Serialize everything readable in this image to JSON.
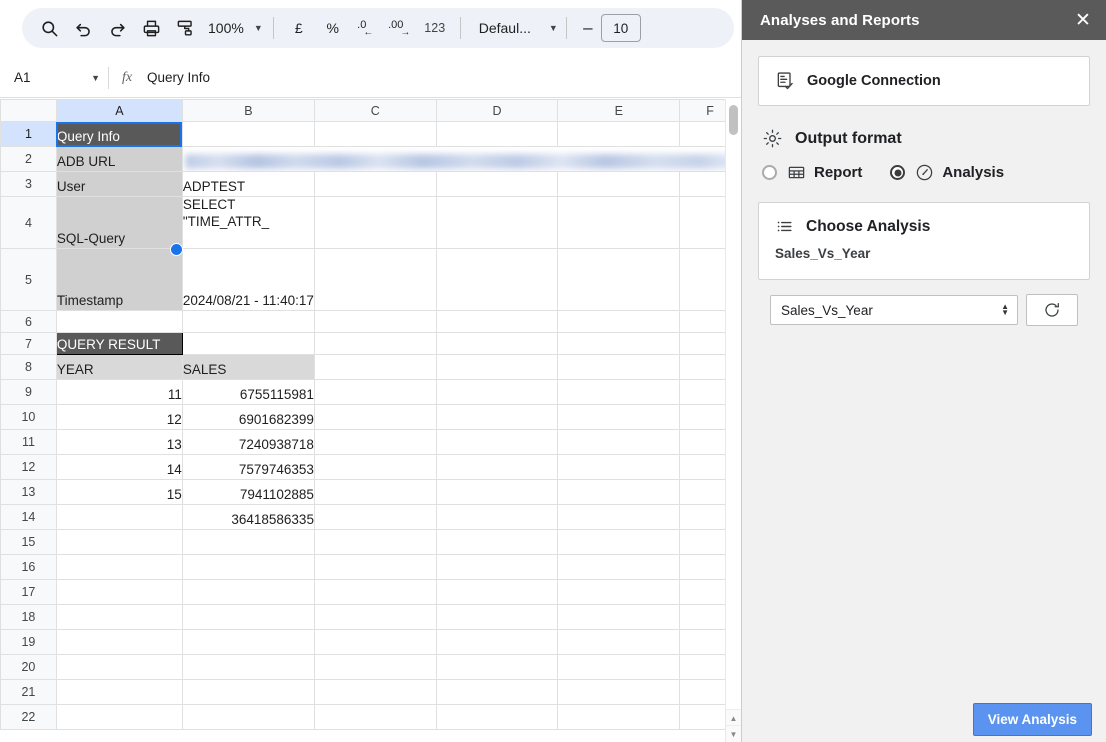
{
  "toolbar": {
    "search_icon": "search-icon",
    "undo_icon": "undo-icon",
    "redo_icon": "redo-icon",
    "print_icon": "print-icon",
    "paint_format_icon": "paint-format-icon",
    "zoom_value": "100%",
    "currency_label": "£",
    "percent_label": "%",
    "decrease_decimal_label": ".0",
    "increase_decimal_label": ".00",
    "number_format_label": "123",
    "font_name": "Defaul...",
    "font_decrease_label": "–",
    "font_size": "10"
  },
  "formula_bar": {
    "name_box": "A1",
    "fx_label": "fx",
    "content": "Query Info"
  },
  "grid": {
    "columns": [
      "A",
      "B",
      "C",
      "D",
      "E",
      "F"
    ],
    "selected_cell": "A1",
    "rows": [
      {
        "n": "1",
        "a": "Query Info",
        "b": "",
        "style": "dark"
      },
      {
        "n": "2",
        "a": "ADB URL",
        "b": "",
        "style": "gray",
        "b_redacted": true
      },
      {
        "n": "3",
        "a": "User",
        "b": "ADPTEST",
        "style": "gray"
      },
      {
        "n": "4",
        "a": "SQL-Query",
        "b": "SELECT",
        "b2": "\"TIME_ATTR_",
        "style": "gray"
      },
      {
        "n": "5",
        "a": "Timestamp",
        "b": "2024/08/21 - 11:40:17",
        "style": "gray"
      },
      {
        "n": "6",
        "a": "",
        "b": "",
        "style": "plain"
      },
      {
        "n": "7",
        "a": "QUERY RESULT",
        "b": "",
        "style": "dark"
      },
      {
        "n": "8",
        "a": "YEAR",
        "b": "SALES",
        "style": "header"
      },
      {
        "n": "9",
        "a": "11",
        "b": "6755115981",
        "style": "data"
      },
      {
        "n": "10",
        "a": "12",
        "b": "6901682399",
        "style": "data"
      },
      {
        "n": "11",
        "a": "13",
        "b": "7240938718",
        "style": "data"
      },
      {
        "n": "12",
        "a": "14",
        "b": "7579746353",
        "style": "data"
      },
      {
        "n": "13",
        "a": "15",
        "b": "7941102885",
        "style": "data"
      },
      {
        "n": "14",
        "a": "",
        "b": "36418586335",
        "style": "data"
      },
      {
        "n": "15",
        "a": "",
        "b": "",
        "style": "plain"
      },
      {
        "n": "16",
        "a": "",
        "b": "",
        "style": "plain"
      },
      {
        "n": "17",
        "a": "",
        "b": "",
        "style": "plain"
      },
      {
        "n": "18",
        "a": "",
        "b": "",
        "style": "plain"
      },
      {
        "n": "19",
        "a": "",
        "b": "",
        "style": "plain"
      },
      {
        "n": "20",
        "a": "",
        "b": "",
        "style": "plain"
      },
      {
        "n": "21",
        "a": "",
        "b": "",
        "style": "plain"
      },
      {
        "n": "22",
        "a": "",
        "b": "",
        "style": "plain"
      }
    ]
  },
  "panel": {
    "title": "Analyses and Reports",
    "close_icon": "close-icon",
    "connection": {
      "icon": "document-check-icon",
      "label": "Google Connection"
    },
    "output_format": {
      "icon": "gear-icon",
      "title": "Output format",
      "options": [
        {
          "label": "Report",
          "icon": "table-icon",
          "selected": false
        },
        {
          "label": "Analysis",
          "icon": "gauge-icon",
          "selected": true
        }
      ]
    },
    "choose_analysis": {
      "icon": "list-icon",
      "title": "Choose Analysis",
      "current_value": "Sales_Vs_Year",
      "select_value": "Sales_Vs_Year",
      "refresh_icon": "refresh-icon"
    },
    "view_analysis_label": "View Analysis",
    "colors": {
      "header_bg": "#5a5a5a",
      "panel_bg": "#f1f1f1",
      "button_bg": "#5b93f0",
      "accent": "#1a73e8"
    }
  }
}
